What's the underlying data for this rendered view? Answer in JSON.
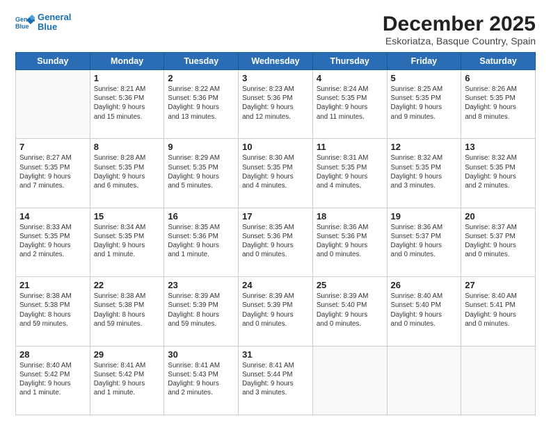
{
  "logo": {
    "line1": "General",
    "line2": "Blue"
  },
  "header": {
    "month": "December 2025",
    "location": "Eskoriatza, Basque Country, Spain"
  },
  "days_of_week": [
    "Sunday",
    "Monday",
    "Tuesday",
    "Wednesday",
    "Thursday",
    "Friday",
    "Saturday"
  ],
  "weeks": [
    [
      {
        "day": "",
        "info": ""
      },
      {
        "day": "1",
        "info": "Sunrise: 8:21 AM\nSunset: 5:36 PM\nDaylight: 9 hours\nand 15 minutes."
      },
      {
        "day": "2",
        "info": "Sunrise: 8:22 AM\nSunset: 5:36 PM\nDaylight: 9 hours\nand 13 minutes."
      },
      {
        "day": "3",
        "info": "Sunrise: 8:23 AM\nSunset: 5:36 PM\nDaylight: 9 hours\nand 12 minutes."
      },
      {
        "day": "4",
        "info": "Sunrise: 8:24 AM\nSunset: 5:35 PM\nDaylight: 9 hours\nand 11 minutes."
      },
      {
        "day": "5",
        "info": "Sunrise: 8:25 AM\nSunset: 5:35 PM\nDaylight: 9 hours\nand 9 minutes."
      },
      {
        "day": "6",
        "info": "Sunrise: 8:26 AM\nSunset: 5:35 PM\nDaylight: 9 hours\nand 8 minutes."
      }
    ],
    [
      {
        "day": "7",
        "info": "Sunrise: 8:27 AM\nSunset: 5:35 PM\nDaylight: 9 hours\nand 7 minutes."
      },
      {
        "day": "8",
        "info": "Sunrise: 8:28 AM\nSunset: 5:35 PM\nDaylight: 9 hours\nand 6 minutes."
      },
      {
        "day": "9",
        "info": "Sunrise: 8:29 AM\nSunset: 5:35 PM\nDaylight: 9 hours\nand 5 minutes."
      },
      {
        "day": "10",
        "info": "Sunrise: 8:30 AM\nSunset: 5:35 PM\nDaylight: 9 hours\nand 4 minutes."
      },
      {
        "day": "11",
        "info": "Sunrise: 8:31 AM\nSunset: 5:35 PM\nDaylight: 9 hours\nand 4 minutes."
      },
      {
        "day": "12",
        "info": "Sunrise: 8:32 AM\nSunset: 5:35 PM\nDaylight: 9 hours\nand 3 minutes."
      },
      {
        "day": "13",
        "info": "Sunrise: 8:32 AM\nSunset: 5:35 PM\nDaylight: 9 hours\nand 2 minutes."
      }
    ],
    [
      {
        "day": "14",
        "info": "Sunrise: 8:33 AM\nSunset: 5:35 PM\nDaylight: 9 hours\nand 2 minutes."
      },
      {
        "day": "15",
        "info": "Sunrise: 8:34 AM\nSunset: 5:35 PM\nDaylight: 9 hours\nand 1 minute."
      },
      {
        "day": "16",
        "info": "Sunrise: 8:35 AM\nSunset: 5:36 PM\nDaylight: 9 hours\nand 1 minute."
      },
      {
        "day": "17",
        "info": "Sunrise: 8:35 AM\nSunset: 5:36 PM\nDaylight: 9 hours\nand 0 minutes."
      },
      {
        "day": "18",
        "info": "Sunrise: 8:36 AM\nSunset: 5:36 PM\nDaylight: 9 hours\nand 0 minutes."
      },
      {
        "day": "19",
        "info": "Sunrise: 8:36 AM\nSunset: 5:37 PM\nDaylight: 9 hours\nand 0 minutes."
      },
      {
        "day": "20",
        "info": "Sunrise: 8:37 AM\nSunset: 5:37 PM\nDaylight: 9 hours\nand 0 minutes."
      }
    ],
    [
      {
        "day": "21",
        "info": "Sunrise: 8:38 AM\nSunset: 5:38 PM\nDaylight: 8 hours\nand 59 minutes."
      },
      {
        "day": "22",
        "info": "Sunrise: 8:38 AM\nSunset: 5:38 PM\nDaylight: 8 hours\nand 59 minutes."
      },
      {
        "day": "23",
        "info": "Sunrise: 8:39 AM\nSunset: 5:39 PM\nDaylight: 8 hours\nand 59 minutes."
      },
      {
        "day": "24",
        "info": "Sunrise: 8:39 AM\nSunset: 5:39 PM\nDaylight: 9 hours\nand 0 minutes."
      },
      {
        "day": "25",
        "info": "Sunrise: 8:39 AM\nSunset: 5:40 PM\nDaylight: 9 hours\nand 0 minutes."
      },
      {
        "day": "26",
        "info": "Sunrise: 8:40 AM\nSunset: 5:40 PM\nDaylight: 9 hours\nand 0 minutes."
      },
      {
        "day": "27",
        "info": "Sunrise: 8:40 AM\nSunset: 5:41 PM\nDaylight: 9 hours\nand 0 minutes."
      }
    ],
    [
      {
        "day": "28",
        "info": "Sunrise: 8:40 AM\nSunset: 5:42 PM\nDaylight: 9 hours\nand 1 minute."
      },
      {
        "day": "29",
        "info": "Sunrise: 8:41 AM\nSunset: 5:42 PM\nDaylight: 9 hours\nand 1 minute."
      },
      {
        "day": "30",
        "info": "Sunrise: 8:41 AM\nSunset: 5:43 PM\nDaylight: 9 hours\nand 2 minutes."
      },
      {
        "day": "31",
        "info": "Sunrise: 8:41 AM\nSunset: 5:44 PM\nDaylight: 9 hours\nand 3 minutes."
      },
      {
        "day": "",
        "info": ""
      },
      {
        "day": "",
        "info": ""
      },
      {
        "day": "",
        "info": ""
      }
    ]
  ]
}
